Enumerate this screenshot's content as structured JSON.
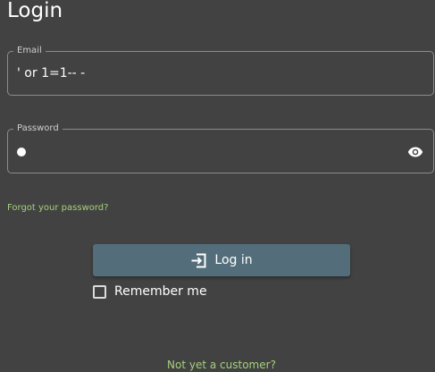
{
  "page": {
    "title": "Login"
  },
  "form": {
    "email": {
      "label": "Email",
      "value": "' or 1=1-- -"
    },
    "password": {
      "label": "Password",
      "masked_char_count": 1,
      "visibility_icon": "eye-icon"
    },
    "forgot_password_label": "Forgot your password?",
    "login_button": {
      "icon": "login-icon",
      "label": "Log in"
    },
    "remember_me": {
      "label": "Remember me",
      "checked": false
    }
  },
  "footer": {
    "register_label": "Not yet a customer?"
  },
  "colors": {
    "background": "#424242",
    "primary_button": "#536e7a",
    "link": "#a5d17b",
    "field_border": "#8c8c8c"
  }
}
